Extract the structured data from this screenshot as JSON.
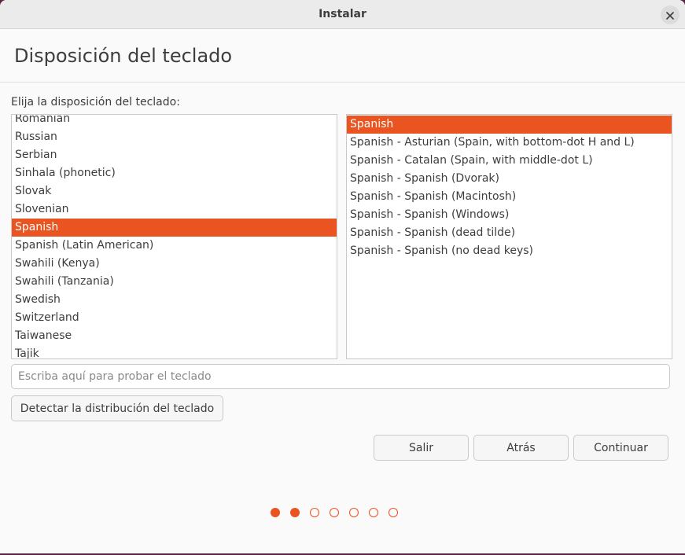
{
  "window": {
    "title": "Instalar"
  },
  "page": {
    "heading": "Disposición del teclado",
    "prompt": "Elija la disposición del teclado:"
  },
  "layouts": {
    "items": [
      {
        "label": "Romanian"
      },
      {
        "label": "Romanian"
      },
      {
        "label": "Russian"
      },
      {
        "label": "Serbian"
      },
      {
        "label": "Sinhala (phonetic)"
      },
      {
        "label": "Slovak"
      },
      {
        "label": "Slovenian"
      },
      {
        "label": "Spanish"
      },
      {
        "label": "Spanish (Latin American)"
      },
      {
        "label": "Swahili (Kenya)"
      },
      {
        "label": "Swahili (Tanzania)"
      },
      {
        "label": "Swedish"
      },
      {
        "label": "Switzerland"
      },
      {
        "label": "Taiwanese"
      },
      {
        "label": "Tajik"
      }
    ],
    "selected": "Spanish"
  },
  "variants": {
    "items": [
      {
        "label": "Spanish"
      },
      {
        "label": "Spanish - Asturian (Spain, with bottom-dot H and L)"
      },
      {
        "label": "Spanish - Catalan (Spain, with middle-dot L)"
      },
      {
        "label": "Spanish - Spanish (Dvorak)"
      },
      {
        "label": "Spanish - Spanish (Macintosh)"
      },
      {
        "label": "Spanish - Spanish (Windows)"
      },
      {
        "label": "Spanish - Spanish (dead tilde)"
      },
      {
        "label": "Spanish - Spanish (no dead keys)"
      }
    ],
    "selected": "Spanish"
  },
  "test_field": {
    "placeholder": "Escriba aquí para probar el teclado",
    "value": ""
  },
  "buttons": {
    "detect": "Detectar la distribución del teclado",
    "quit": "Salir",
    "back": "Atrás",
    "continue": "Continuar"
  },
  "progress": {
    "total_steps": 7,
    "completed_steps": 2
  },
  "colors": {
    "accent": "#e95420"
  },
  "icons": {
    "close": "close-icon"
  }
}
